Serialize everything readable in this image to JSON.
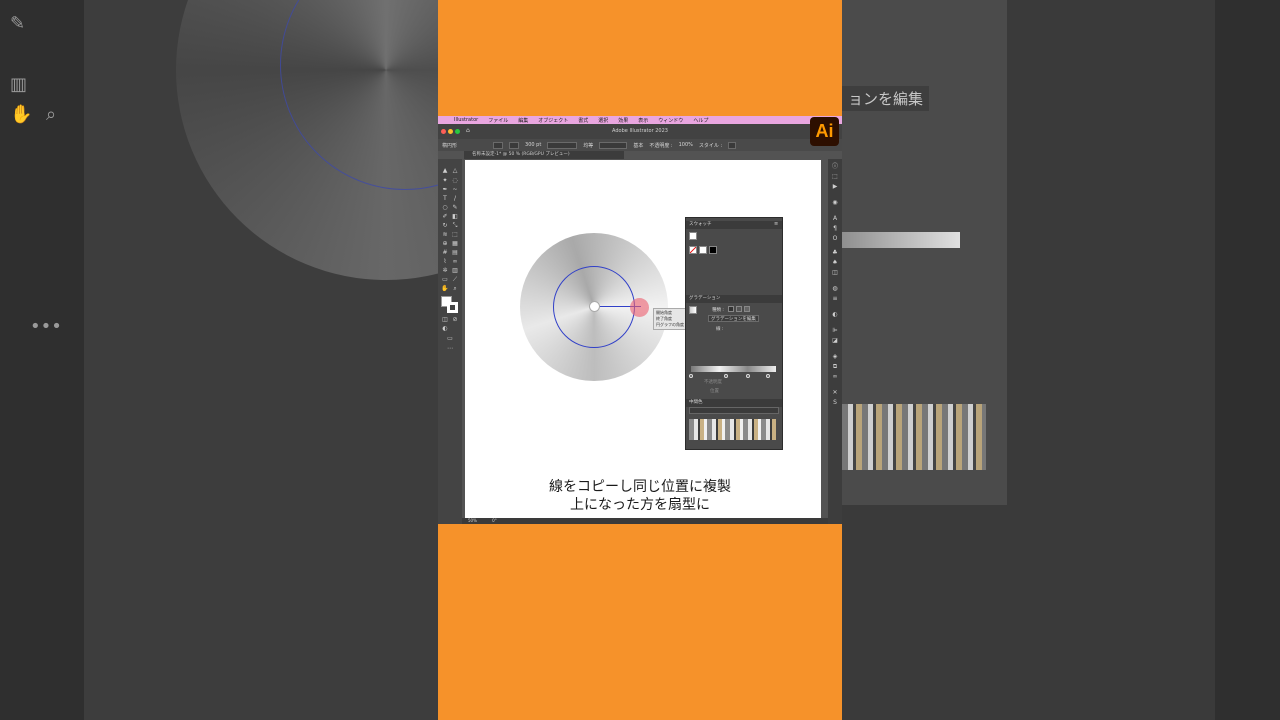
{
  "app": {
    "window_title": "Adobe Illustrator 2023",
    "logo_text": "Ai",
    "menu": [
      "Illustrator",
      "ファイル",
      "編集",
      "オブジェクト",
      "書式",
      "選択",
      "効果",
      "表示",
      "ウィンドウ",
      "ヘルプ"
    ],
    "control_bar": {
      "selection_label": "楕円形",
      "stroke_width": "300 pt",
      "stroke_profile": "均等",
      "brush": "基本",
      "opacity_label": "不透明度 :",
      "opacity_value": "100%",
      "style_label": "スタイル :"
    },
    "doc_tab": "名称未設定-1* @ 50 % (RGB/GPU プレビュー)",
    "status": {
      "zoom": "50%",
      "rotation": "0°"
    }
  },
  "tooltip": [
    "開始角度",
    "終了角度",
    "円グラフの角度"
  ],
  "swatches_panel": {
    "title": "スウォッチ"
  },
  "gradient_panel": {
    "title": "グラデーション",
    "type_label": "種類 :",
    "edit_button": "グラデーションを編集",
    "stroke_label": "線 :",
    "opacity_label": "不透明度",
    "position_label": "位置"
  },
  "brushes_panel": {
    "title": "中間色"
  },
  "caption": {
    "line1": "線をコピーし同じ位置に複製",
    "line2": "上になった方を扇型に"
  },
  "background_right": {
    "edit_label": "ョンを編集"
  },
  "colors": {
    "accent_orange": "#f6922a",
    "ai_logo_bg": "#2d0f00",
    "ai_logo_fg": "#ff9a00",
    "selection_blue": "#3140c8",
    "cursor_highlight": "#ed5e6e"
  }
}
